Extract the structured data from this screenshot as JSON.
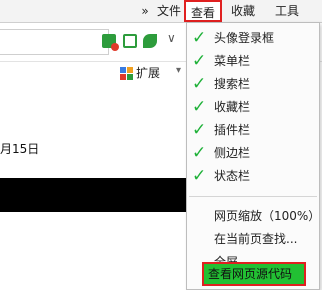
{
  "menubar": {
    "chevron": "»",
    "items": [
      "文件",
      "查看",
      "收藏",
      "工具"
    ]
  },
  "toolbar": {
    "ext_label": "扩展",
    "ext_arrow": "▾",
    "chevron": "∨"
  },
  "page": {
    "date_fragment": "月15日"
  },
  "view_menu": {
    "items": [
      {
        "label": "头像登录框",
        "checked": true
      },
      {
        "label": "菜单栏",
        "checked": true
      },
      {
        "label": "搜索栏",
        "checked": true
      },
      {
        "label": "收藏栏",
        "checked": true
      },
      {
        "label": "插件栏",
        "checked": true
      },
      {
        "label": "侧边栏",
        "checked": true
      },
      {
        "label": "状态栏",
        "checked": true
      },
      {
        "label": "网页缩放（100%）",
        "checked": false
      },
      {
        "label": "在当前页查找...",
        "checked": false
      },
      {
        "label": "全屏",
        "checked": false
      }
    ],
    "view_source": "查看网页源代码"
  },
  "colors": {
    "check": "#1fb139",
    "highlight": "#22c033",
    "outline": "#e02020"
  }
}
